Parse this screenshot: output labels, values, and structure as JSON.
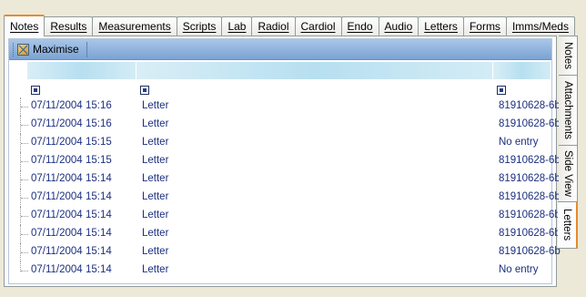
{
  "top_tabs": [
    {
      "label": "Notes",
      "active": true
    },
    {
      "label": "Results",
      "active": false
    },
    {
      "label": "Measurements",
      "active": false
    },
    {
      "label": "Scripts",
      "active": false
    },
    {
      "label": "Lab",
      "active": false
    },
    {
      "label": "Radiol",
      "active": false
    },
    {
      "label": "Cardiol",
      "active": false
    },
    {
      "label": "Endo",
      "active": false
    },
    {
      "label": "Audio",
      "active": false
    },
    {
      "label": "Letters",
      "active": false
    },
    {
      "label": "Forms",
      "active": false
    },
    {
      "label": "Imms/Meds",
      "active": false
    }
  ],
  "toolbar": {
    "maximise_label": "Maximise"
  },
  "side_tabs": [
    {
      "label": "Notes",
      "active": false
    },
    {
      "label": "Attachments",
      "active": false
    },
    {
      "label": "Side View",
      "active": false
    },
    {
      "label": "Letters",
      "active": true
    }
  ],
  "letters": [
    {
      "date": "07/11/2004",
      "time": "15:16",
      "type": "Letter",
      "ref": "81910628-6b"
    },
    {
      "date": "07/11/2004",
      "time": "15:16",
      "type": "Letter",
      "ref": "81910628-6b"
    },
    {
      "date": "07/11/2004",
      "time": "15:15",
      "type": "Letter",
      "ref": "No entry"
    },
    {
      "date": "07/11/2004",
      "time": "15:15",
      "type": "Letter",
      "ref": "81910628-6b"
    },
    {
      "date": "07/11/2004",
      "time": "15:14",
      "type": "Letter",
      "ref": "81910628-6b"
    },
    {
      "date": "07/11/2004",
      "time": "15:14",
      "type": "Letter",
      "ref": "81910628-6b"
    },
    {
      "date": "07/11/2004",
      "time": "15:14",
      "type": "Letter",
      "ref": "81910628-6b"
    },
    {
      "date": "07/11/2004",
      "time": "15:14",
      "type": "Letter",
      "ref": "81910628-6b"
    },
    {
      "date": "07/11/2004",
      "time": "15:14",
      "type": "Letter",
      "ref": "81910628-6b"
    },
    {
      "date": "07/11/2004",
      "time": "15:14",
      "type": "Letter",
      "ref": "No entry"
    }
  ],
  "colors": {
    "accent": "#e68b2c",
    "text_blue": "#1b2f80",
    "toolbar": "#7ba3d3"
  }
}
